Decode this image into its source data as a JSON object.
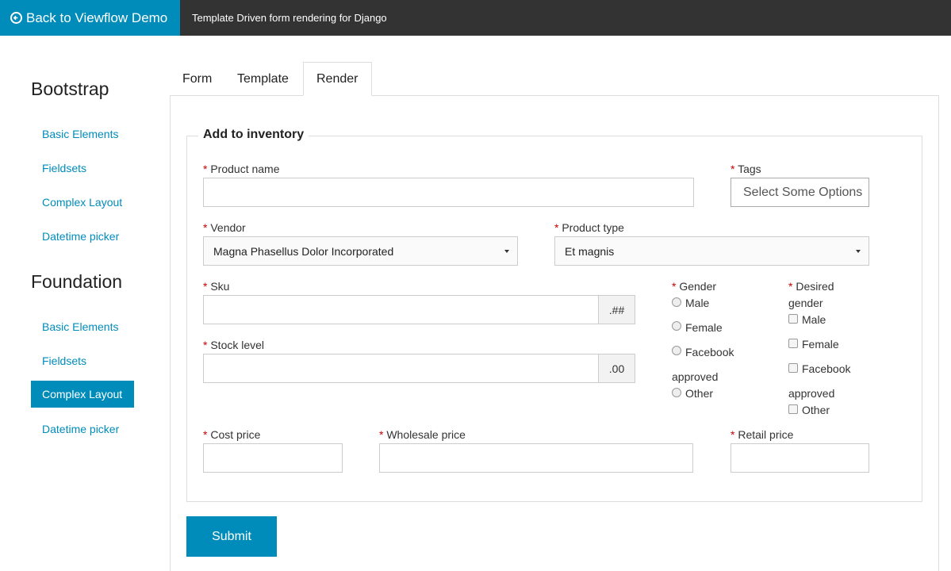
{
  "topbar": {
    "back_label": "Back to Viewflow Demo",
    "title": "Template Driven form rendering for Django"
  },
  "sidebar": {
    "sections": [
      {
        "heading": "Bootstrap",
        "items": [
          "Basic Elements",
          "Fieldsets",
          "Complex Layout",
          "Datetime picker"
        ]
      },
      {
        "heading": "Foundation",
        "items": [
          "Basic Elements",
          "Fieldsets",
          "Complex Layout",
          "Datetime picker"
        ]
      }
    ],
    "active": "Foundation / Complex Layout"
  },
  "tabs": [
    "Form",
    "Template",
    "Render"
  ],
  "active_tab": "Render",
  "form": {
    "legend": "Add to inventory",
    "required_marker": "*",
    "product_name": {
      "label": "Product name",
      "value": ""
    },
    "tags": {
      "label": "Tags",
      "placeholder": "Select Some Options"
    },
    "vendor": {
      "label": "Vendor",
      "selected": "Magna Phasellus Dolor Incorporated"
    },
    "product_type": {
      "label": "Product type",
      "selected": "Et magnis"
    },
    "sku": {
      "label": "Sku",
      "value": "",
      "postfix": ".##"
    },
    "stock_level": {
      "label": "Stock level",
      "value": "",
      "postfix": ".00"
    },
    "gender": {
      "label": "Gender",
      "options": [
        "Male",
        "Female",
        "Facebook",
        "approved",
        "Other"
      ]
    },
    "desired_gender": {
      "label_line1": "Desired",
      "label_line2": "gender",
      "options": [
        "Male",
        "Female",
        "Facebook",
        "approved",
        "Other"
      ]
    },
    "cost_price": {
      "label": "Cost price",
      "value": ""
    },
    "wholesale_price": {
      "label": "Wholesale price",
      "value": ""
    },
    "retail_price": {
      "label": "Retail price",
      "value": ""
    },
    "submit_label": "Submit"
  },
  "colors": {
    "accent": "#008cba",
    "topbar": "#333333",
    "required": "#cc0000"
  }
}
